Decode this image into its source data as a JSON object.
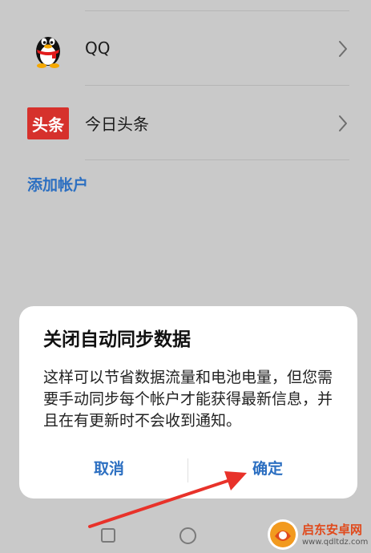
{
  "accounts": [
    {
      "icon": "qq-penguin-icon",
      "label": "QQ"
    },
    {
      "icon": "toutiao-logo-icon",
      "label": "今日头条",
      "logo_text": "头条"
    }
  ],
  "add_account_label": "添加帐户",
  "dialog": {
    "title": "关闭自动同步数据",
    "message": "这样可以节省数据流量和电池电量，但您需要手动同步每个帐户才能获得最新信息，并且在有更新时不会收到通知。",
    "cancel_label": "取消",
    "confirm_label": "确定"
  },
  "navbar": {
    "items": [
      "recents-square-icon",
      "home-circle-icon"
    ]
  },
  "watermark": {
    "name": "启东安卓网",
    "url": "www.qdltdz.com"
  },
  "colors": {
    "accent": "#2c6fc1",
    "overlay_background": "#c9c9c9",
    "annotation_arrow": "#e8322a"
  }
}
